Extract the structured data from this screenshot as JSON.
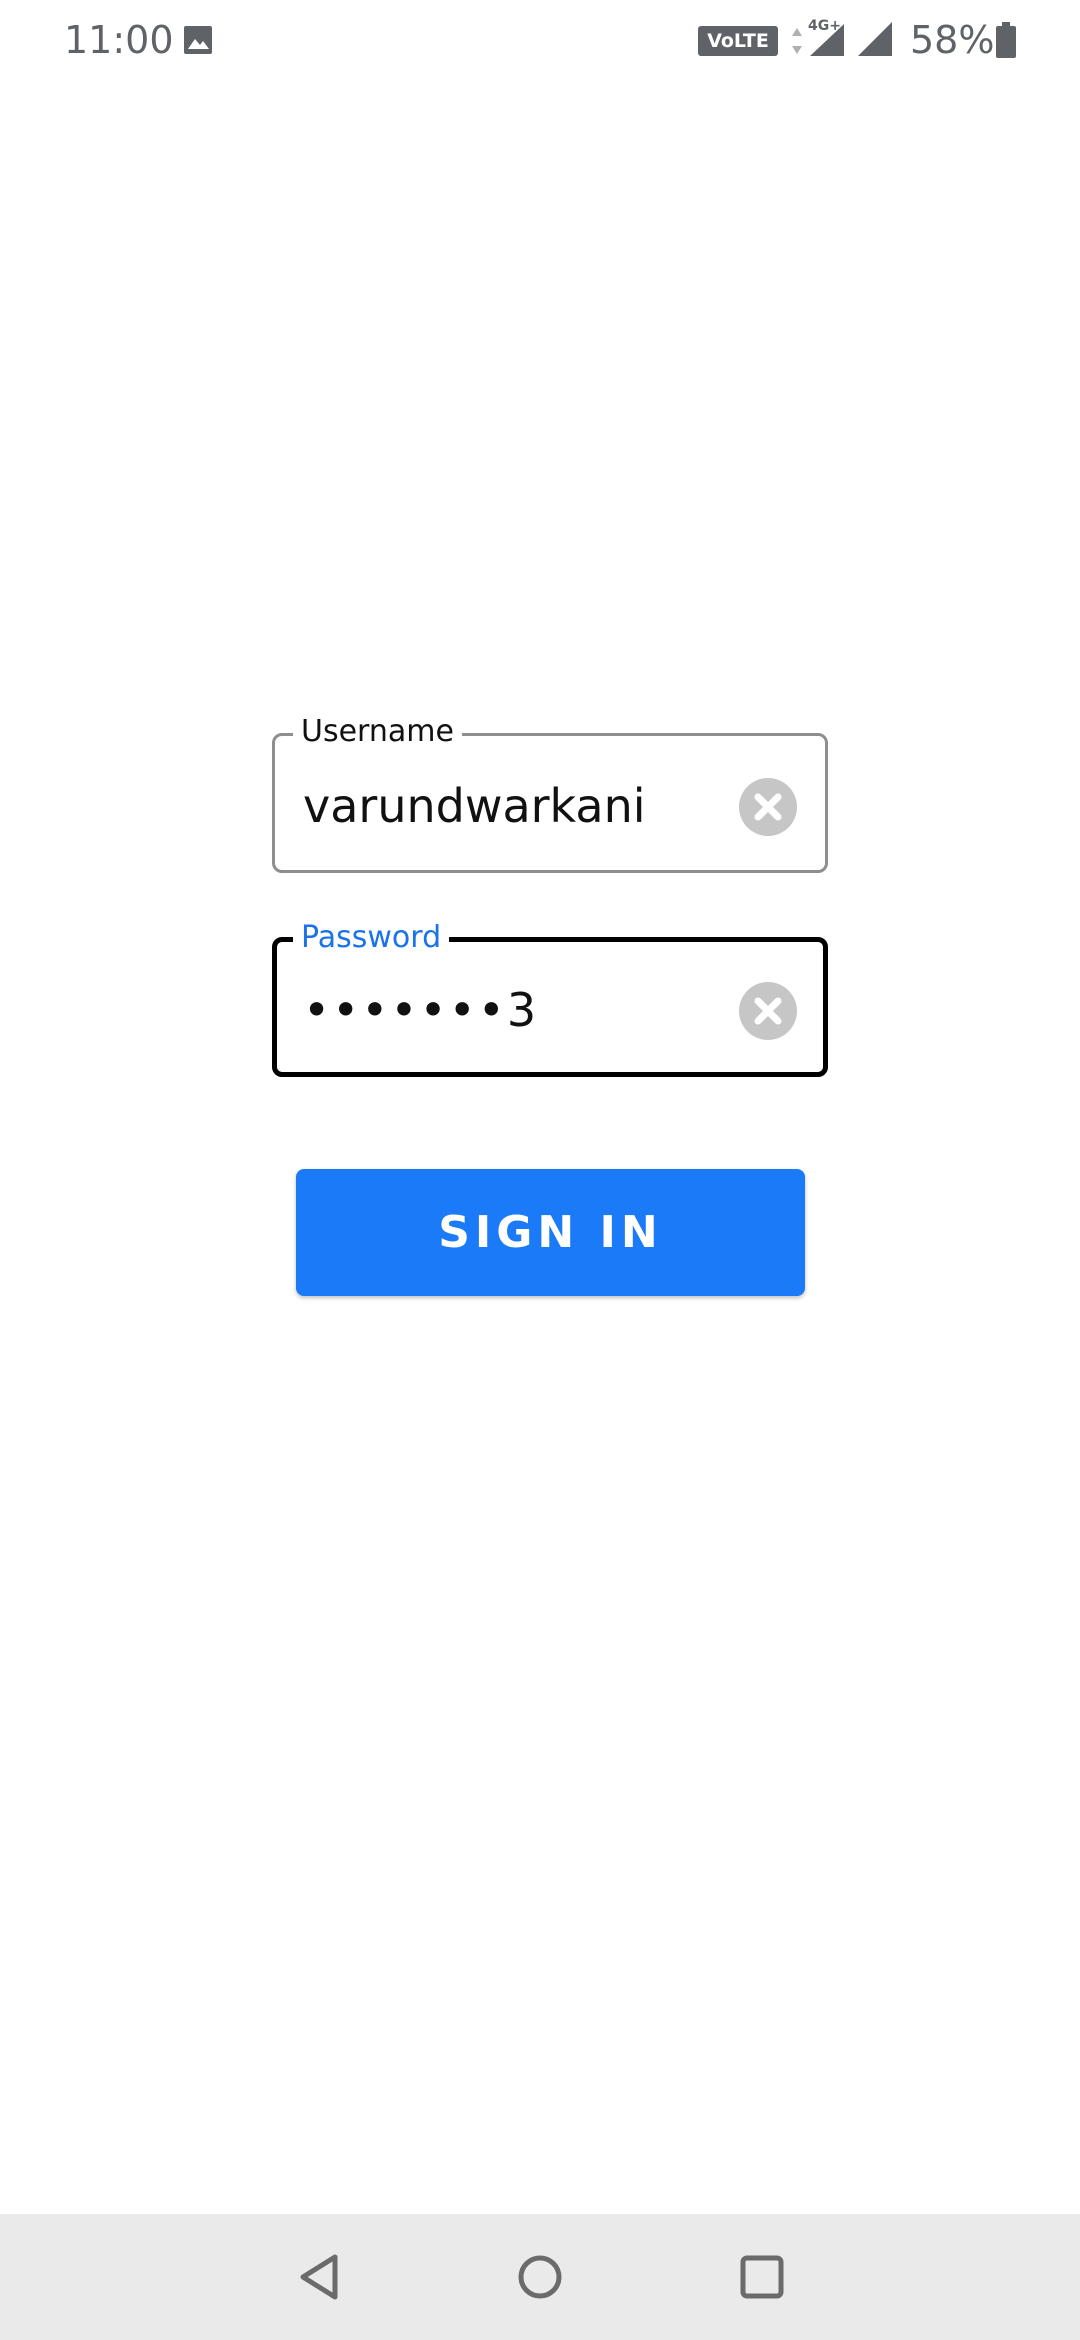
{
  "status_bar": {
    "time": "11:00",
    "network_badge": "VoLTE 1",
    "network_type": "4G+",
    "battery": "58%",
    "icons": [
      "gallery-icon",
      "data-arrows-icon",
      "signal-4g-icon",
      "signal-icon",
      "battery-icon"
    ]
  },
  "login": {
    "username": {
      "label": "Username",
      "value": "varundwarkani"
    },
    "password": {
      "label": "Password",
      "value": "•••••••3",
      "focused": true
    },
    "signin_label": "SIGN IN"
  },
  "nav_bar": {
    "buttons": [
      "back-icon",
      "home-icon",
      "recents-icon"
    ]
  },
  "colors": {
    "accent": "#1a7af8",
    "focused_label": "#1a73e8",
    "clear_icon": "#c6c6c6",
    "nav_bar": "#eaeaea",
    "status_text": "#5f6368"
  }
}
